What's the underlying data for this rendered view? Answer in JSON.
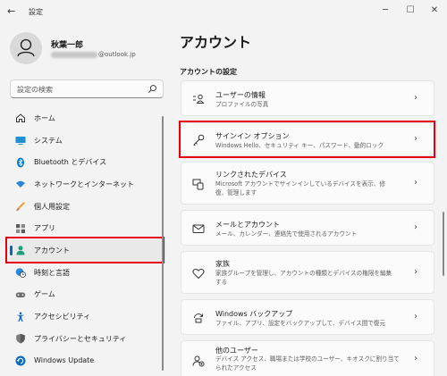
{
  "window": {
    "title": "設定",
    "back_icon": "back-arrow-icon",
    "minimize_icon": "minimize-icon",
    "maximize_icon": "maximize-icon",
    "close_icon": "close-icon"
  },
  "profile": {
    "name": "秋葉一郎",
    "email_domain": "@outlook.jp"
  },
  "search": {
    "placeholder": "設定の検索"
  },
  "nav": {
    "items": [
      {
        "label": "ホーム",
        "icon": "home-icon"
      },
      {
        "label": "システム",
        "icon": "display-icon"
      },
      {
        "label": "Bluetooth とデバイス",
        "icon": "bluetooth-icon"
      },
      {
        "label": "ネットワークとインターネット",
        "icon": "wifi-icon"
      },
      {
        "label": "個人用設定",
        "icon": "brush-icon"
      },
      {
        "label": "アプリ",
        "icon": "apps-icon"
      },
      {
        "label": "アカウント",
        "icon": "account-icon",
        "selected": true
      },
      {
        "label": "時刻と言語",
        "icon": "globe-clock-icon"
      },
      {
        "label": "ゲーム",
        "icon": "gamepad-icon"
      },
      {
        "label": "アクセシビリティ",
        "icon": "accessibility-icon"
      },
      {
        "label": "プライバシーとセキュリティ",
        "icon": "shield-icon"
      },
      {
        "label": "Windows Update",
        "icon": "update-icon"
      }
    ]
  },
  "main": {
    "title": "アカウント",
    "section": "アカウントの設定",
    "cards": [
      {
        "title": "ユーザーの情報",
        "desc": "プロファイルの写真",
        "icon": "user-info-icon"
      },
      {
        "title": "サインイン オプション",
        "desc": "Windows Hello、セキュリティ キー、パスワード、動的ロック",
        "icon": "key-icon"
      },
      {
        "title": "リンクされたデバイス",
        "desc": "Microsoft アカウントでサインインしているデバイスを表示、修復、管理します",
        "icon": "linked-devices-icon"
      },
      {
        "title": "メールとアカウント",
        "desc": "メール、カレンダー、連絡先で使用されるアカウント",
        "icon": "mail-icon"
      },
      {
        "title": "家族",
        "desc": "家族グループを管理し、アカウントの種類とデバイスの権限を編集する",
        "icon": "family-heart-icon"
      },
      {
        "title": "Windows バックアップ",
        "desc": "ファイル、アプリ、設定をバックアップして、デバイス間で復元",
        "icon": "backup-icon"
      },
      {
        "title": "他のユーザー",
        "desc": "デバイス アクセス、職場または学校のユーザー、キオスクに割り当てられたアクセス",
        "icon": "other-users-icon"
      }
    ]
  },
  "colors": {
    "accent": "#0067c0",
    "highlight_box": "#e60012",
    "background": "#f3f3f3",
    "card": "#fbfbfb"
  }
}
